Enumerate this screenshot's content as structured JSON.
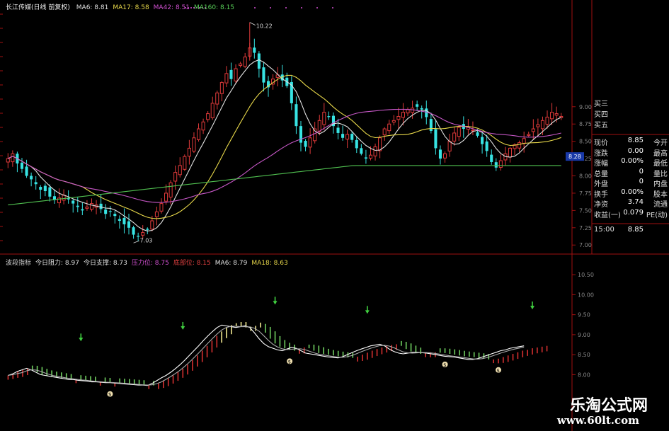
{
  "header_main": {
    "title": "长江传媒(日线 前复权)",
    "items": [
      {
        "label": "MA6: 8.81",
        "color": "#e0e0e0"
      },
      {
        "label": "MA17: 8.58",
        "color": "#e8d84a"
      },
      {
        "label": "MA42: 8.51",
        "color": "#d050d0"
      },
      {
        "label": "MA160: 8.15",
        "color": "#58d058"
      }
    ]
  },
  "header_sub": {
    "items": [
      {
        "label": "波段指标",
        "color": "#cccccc"
      },
      {
        "label": "今日阻力: 8.97",
        "color": "#e0e0e0"
      },
      {
        "label": "今日支撑: 8.73",
        "color": "#e0e0e0"
      },
      {
        "label": "压力位: 8.75",
        "color": "#d050d0"
      },
      {
        "label": "底部位: 8.15",
        "color": "#e04040"
      },
      {
        "label": "MA6: 8.79",
        "color": "#e0e0e0"
      },
      {
        "label": "MA18: 8.63",
        "color": "#e8d84a"
      }
    ]
  },
  "quote_panel": {
    "top_labels": [
      "买三",
      "买四",
      "买五"
    ],
    "top_values": [
      "9.00",
      "8.75",
      "8.50"
    ],
    "current_price_tag": "8.28",
    "rows": [
      {
        "k": "现价",
        "v": "8.85",
        "k2": "今开"
      },
      {
        "k": "涨跌",
        "v": "0.00",
        "k2": "最高"
      },
      {
        "k": "涨幅",
        "v": "0.00%",
        "k2": "最低"
      },
      {
        "k": "总量",
        "v": "0",
        "k2": "量比"
      },
      {
        "k": "外盘",
        "v": "0",
        "k2": "内盘"
      },
      {
        "k": "换手",
        "v": "0.00%",
        "k2": "股本"
      },
      {
        "k": "净资",
        "v": "3.74",
        "k2": "流通"
      },
      {
        "k": "收益(一)",
        "v": "0.079",
        "k2": "PE(动)"
      }
    ],
    "time": "15:00",
    "time_price": "8.85"
  },
  "watermark": {
    "title": "乐淘公式网",
    "url": "www.60lt.com"
  },
  "colors": {
    "up": "#e03a3a",
    "down": "#37e3e3",
    "ma6": "#e0e0e0",
    "ma17": "#e8d84a",
    "ma42": "#c858c8",
    "ma160": "#50c050",
    "axis": "#a01010",
    "wave_up": "#d83030",
    "wave_down": "#70d060",
    "wave_peak": "#f0e890"
  },
  "chart_data": [
    {
      "type": "candlestick",
      "ylim": [
        6.9,
        10.4
      ],
      "yticks": [
        "7.00",
        "7.25",
        "7.50",
        "7.75",
        "8.00",
        "8.25",
        "8.50",
        "8.75",
        "9.00"
      ],
      "annotations": [
        {
          "text": "10.22",
          "index": 52,
          "value": 10.22
        },
        {
          "text": "7.03",
          "index": 27,
          "value": 7.03
        }
      ],
      "close": [
        8.25,
        8.32,
        8.18,
        8.1,
        8.0,
        7.95,
        7.88,
        7.8,
        7.78,
        7.7,
        7.65,
        7.68,
        7.72,
        7.66,
        7.6,
        7.55,
        7.5,
        7.55,
        7.6,
        7.58,
        7.52,
        7.45,
        7.48,
        7.42,
        7.35,
        7.3,
        7.25,
        7.15,
        7.12,
        7.18,
        7.22,
        7.35,
        7.48,
        7.6,
        7.75,
        7.9,
        8.05,
        8.15,
        8.28,
        8.4,
        8.55,
        8.68,
        8.78,
        8.9,
        9.05,
        9.2,
        9.35,
        9.48,
        9.4,
        9.55,
        9.62,
        9.72,
        9.85,
        9.78,
        9.55,
        9.35,
        9.28,
        9.4,
        9.46,
        9.38,
        9.3,
        9.05,
        8.72,
        8.48,
        8.42,
        8.55,
        8.68,
        8.8,
        8.92,
        8.85,
        8.72,
        8.62,
        8.55,
        8.6,
        8.52,
        8.4,
        8.32,
        8.25,
        8.3,
        8.42,
        8.55,
        8.68,
        8.75,
        8.8,
        8.86,
        8.92,
        8.96,
        8.98,
        9.0,
        8.96,
        8.85,
        8.65,
        8.4,
        8.25,
        8.32,
        8.5,
        8.62,
        8.7,
        8.68,
        8.7,
        8.66,
        8.58,
        8.46,
        8.36,
        8.2,
        8.12,
        8.22,
        8.32,
        8.4,
        8.45,
        8.48,
        8.54,
        8.6,
        8.68,
        8.74,
        8.8,
        8.85,
        8.92,
        8.9,
        8.86
      ],
      "ma160_level": [
        7.58,
        8.15
      ]
    },
    {
      "type": "bar",
      "title": "波段指标",
      "ylim": [
        7.6,
        10.75
      ],
      "yticks": [
        "8.00",
        "8.50",
        "9.00",
        "9.50",
        "10.00",
        "10.50"
      ],
      "values": [
        7.98,
        8.02,
        8.08,
        8.12,
        8.16,
        8.12,
        8.06,
        8.0,
        7.98,
        7.96,
        7.94,
        7.92,
        7.9,
        7.88,
        7.88,
        7.86,
        7.85,
        7.84,
        7.82,
        7.82,
        7.81,
        7.8,
        7.8,
        7.79,
        7.78,
        7.77,
        7.76,
        7.75,
        7.74,
        7.74,
        7.73,
        7.78,
        7.85,
        7.92,
        7.98,
        8.06,
        8.15,
        8.25,
        8.36,
        8.48,
        8.6,
        8.72,
        8.85,
        8.97,
        9.08,
        9.18,
        9.24,
        9.22,
        9.2,
        9.18,
        9.2,
        9.22,
        9.18,
        9.05,
        8.9,
        8.78,
        8.7,
        8.66,
        8.62,
        8.6,
        8.64,
        8.68,
        8.66,
        8.6,
        8.54,
        8.52,
        8.5,
        8.48,
        8.46,
        8.44,
        8.43,
        8.42,
        8.45,
        8.5,
        8.55,
        8.6,
        8.64,
        8.68,
        8.72,
        8.74,
        8.76,
        8.72,
        8.64,
        8.58,
        8.54,
        8.52,
        8.54,
        8.56,
        8.56,
        8.55,
        8.54,
        8.52,
        8.5,
        8.48,
        8.46,
        8.45,
        8.44,
        8.42,
        8.4,
        8.38,
        8.38,
        8.4,
        8.44,
        8.48,
        8.52,
        8.56,
        8.6,
        8.62,
        8.66,
        8.68,
        8.7,
        8.72
      ],
      "down_arrows": [
        15,
        36,
        55,
        74,
        108
      ],
      "money_marks": [
        21,
        58,
        90,
        101
      ]
    }
  ]
}
